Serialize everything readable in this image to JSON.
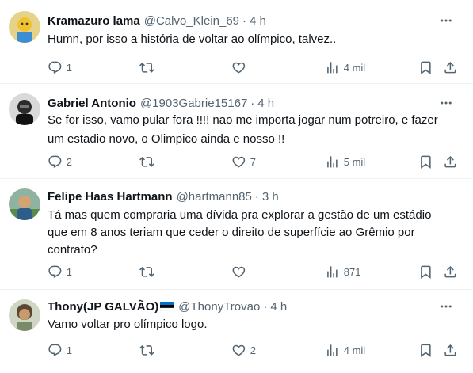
{
  "tweets": [
    {
      "name": "Kramazuro lama",
      "handle": "@Calvo_Klein_69",
      "dot": "·",
      "time": "4 h",
      "text": [
        "Humn, por isso a história de voltar ao olímpico, talvez.."
      ],
      "replies": "1",
      "retweets": "",
      "likes": "",
      "views": "4 mil"
    },
    {
      "name": "Gabriel Antonio",
      "handle": "@1903Gabrie15167",
      "dot": "·",
      "time": "4 h",
      "text": [
        "Se for isso, vamo pular fora !!!! nao me importa jogar num potreiro, e fazer",
        "um estadio novo, o Olimpico ainda e nosso !!"
      ],
      "replies": "2",
      "retweets": "",
      "likes": "7",
      "views": "5 mil"
    },
    {
      "name": "Felipe Haas Hartmann",
      "handle": "@hartmann85",
      "dot": "·",
      "time": "3 h",
      "text": [
        "Tá mas quem compraria uma dívida pra explorar a gestão de um estádio",
        "que em 8 anos teriam que ceder o direito de superfície ao Grêmio por",
        "contrato?"
      ],
      "replies": "1",
      "retweets": "",
      "likes": "",
      "views": "871"
    },
    {
      "name": "Thony(JP GALVÃO)",
      "handle": "@ThonyTrovao",
      "dot": "·",
      "time": "4 h",
      "text": [
        "Vamo voltar pro olímpico logo."
      ],
      "replies": "1",
      "retweets": "",
      "likes": "2",
      "views": "4 mil"
    }
  ],
  "icons": {
    "more": "more-horizontal-icon",
    "reply": "reply-icon",
    "retweet": "retweet-icon",
    "like": "heart-icon",
    "views": "views-chart-icon",
    "bookmark": "bookmark-icon",
    "share": "share-icon"
  },
  "colors": {
    "text": "#0f1419",
    "secondary": "#536471",
    "divider": "#eff3f4"
  }
}
